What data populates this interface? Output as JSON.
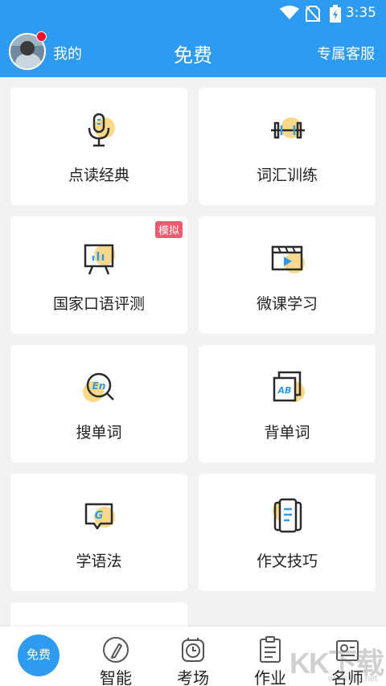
{
  "status_bar": {
    "time": "3:35"
  },
  "header": {
    "my_label": "我的",
    "title": "免费",
    "service_label": "专属客服"
  },
  "cards": [
    {
      "label": "点读经典",
      "icon": "microphone-icon"
    },
    {
      "label": "词汇训练",
      "icon": "dumbbell-icon"
    },
    {
      "label": "国家口语评测",
      "icon": "presentation-board-icon",
      "badge": "模拟"
    },
    {
      "label": "微课学习",
      "icon": "video-play-icon"
    },
    {
      "label": "搜单词",
      "icon": "search-en-icon"
    },
    {
      "label": "背单词",
      "icon": "ab-cards-icon"
    },
    {
      "label": "学语法",
      "icon": "grammar-chat-icon"
    },
    {
      "label": "作文技巧",
      "icon": "document-icon"
    }
  ],
  "bottom_nav": [
    {
      "label": "免费",
      "icon": "free-bubble"
    },
    {
      "label": "智能",
      "icon": "pen-circle-icon"
    },
    {
      "label": "考场",
      "icon": "clock-icon"
    },
    {
      "label": "作业",
      "icon": "clipboard-icon"
    },
    {
      "label": "名师",
      "icon": "teacher-card-icon"
    }
  ],
  "watermark": {
    "main": "KK下载",
    "sub": "www.kkx.net"
  },
  "colors": {
    "primary": "#2e9bf0",
    "accent_yellow": "#fbd98a",
    "badge": "#f05a6e",
    "notification": "#f0102a"
  }
}
